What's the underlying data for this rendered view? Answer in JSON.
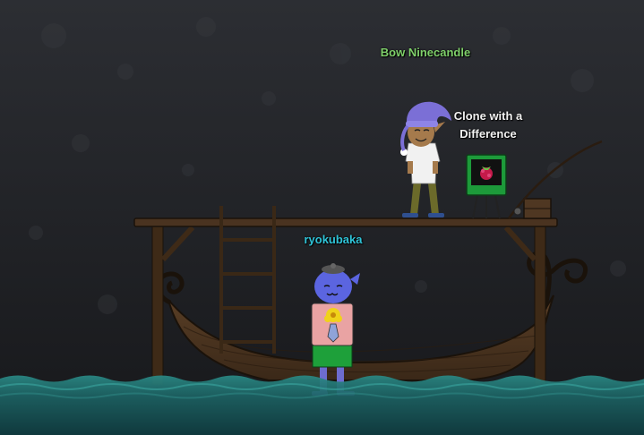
{
  "players": {
    "npc_name": "Bow Ninecandle",
    "player_name": "ryokubaka"
  },
  "objects": {
    "computer_label": "Clone with a Difference",
    "computer_icon": "raspberry-pi-icon"
  },
  "colors": {
    "npc_name": "#7fd06a",
    "player_name": "#2fc4d8",
    "object_label": "#f2f2f2",
    "water": "#1f6f70",
    "boat_wood": "#4a3320",
    "background": "#1e2024"
  }
}
